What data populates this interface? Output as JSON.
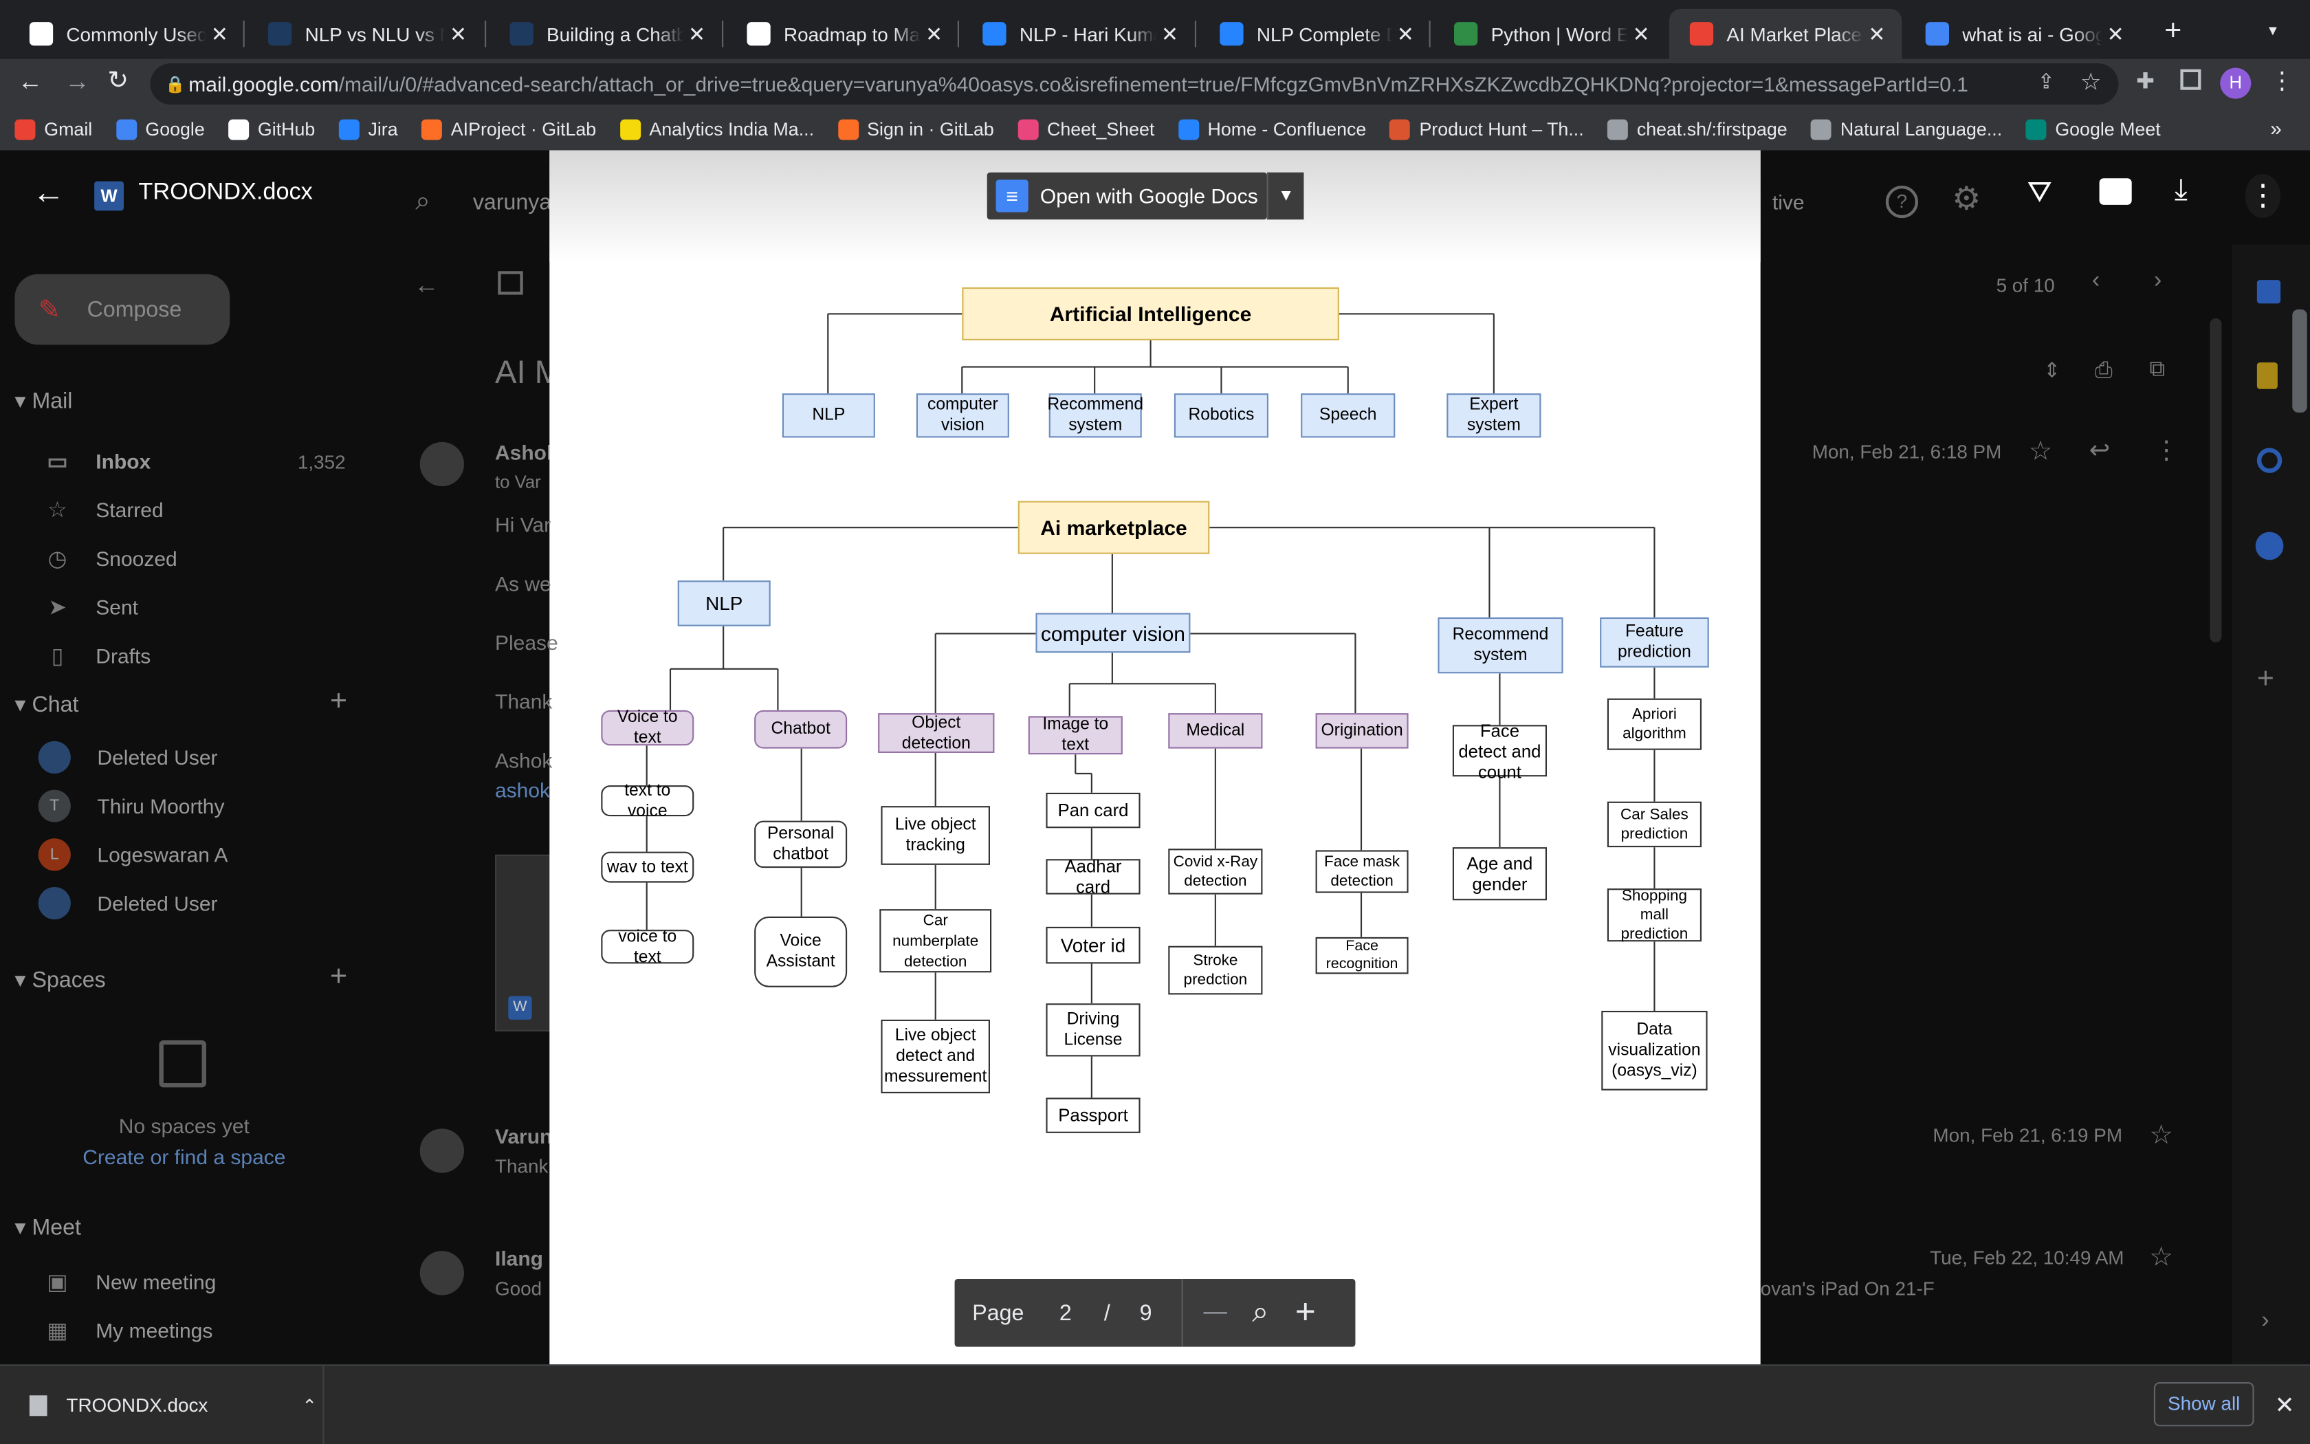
{
  "browser": {
    "tabs": [
      {
        "title": "Commonly Used M",
        "fav": "#ffffff"
      },
      {
        "title": "NLP vs NLU vs NLG",
        "fav": "#1e3a5f"
      },
      {
        "title": "Building a Chatbot",
        "fav": "#1e3a5f"
      },
      {
        "title": "Roadmap to Maste",
        "fav": "#ffffff"
      },
      {
        "title": "NLP - Hari Kumar F",
        "fav": "#2684ff"
      },
      {
        "title": "NLP Complete Doc",
        "fav": "#2684ff"
      },
      {
        "title": "Python | Word Emb",
        "fav": "#2f8d46"
      },
      {
        "title": "AI Market Place - C",
        "fav": "#ea4335"
      },
      {
        "title": "what is ai - Google",
        "fav": "#4285f4"
      }
    ],
    "new_tab": "+",
    "url_host": "mail.google.com",
    "url_path": "/mail/u/0/#advanced-search/attach_or_drive=true&query=varunya%40oasys.co&isrefinement=true/FMfcgzGmvBnVmZRHXsZKZwcdbZQHKDNq?projector=1&messagePartId=0.1",
    "profile": "H",
    "bookmarks": [
      {
        "label": "Gmail",
        "color": "#ea4335"
      },
      {
        "label": "Google",
        "color": "#4285f4"
      },
      {
        "label": "GitHub",
        "color": "#ffffff"
      },
      {
        "label": "Jira",
        "color": "#2684ff"
      },
      {
        "label": "AIProject · GitLab",
        "color": "#fc6d26"
      },
      {
        "label": "Analytics India Ma...",
        "color": "#f5d90a"
      },
      {
        "label": "Sign in · GitLab",
        "color": "#fc6d26"
      },
      {
        "label": "Cheet_Sheet",
        "color": "#e8467c"
      },
      {
        "label": "Home - Confluence",
        "color": "#2684ff"
      },
      {
        "label": "Product Hunt – Th...",
        "color": "#da552f"
      },
      {
        "label": "cheat.sh/:firstpage",
        "color": "#9aa0a6"
      },
      {
        "label": "Natural Language...",
        "color": "#9aa0a6"
      },
      {
        "label": "Google Meet",
        "color": "#00897b"
      }
    ],
    "overflow": "»"
  },
  "gmail": {
    "search_text": "varunya",
    "compose": "Compose",
    "mail_header": "Mail",
    "nav": [
      {
        "label": "Inbox",
        "count": "1,352",
        "icon": "inbox-icon"
      },
      {
        "label": "Starred",
        "count": "",
        "icon": "star-icon"
      },
      {
        "label": "Snoozed",
        "count": "",
        "icon": "clock-icon"
      },
      {
        "label": "Sent",
        "count": "",
        "icon": "send-icon"
      },
      {
        "label": "Drafts",
        "count": "",
        "icon": "draft-icon"
      }
    ],
    "chat_header": "Chat",
    "chats": [
      {
        "name": "Deleted User",
        "initial": "",
        "color": "#3c6db0"
      },
      {
        "name": "Thiru Moorthy",
        "initial": "T",
        "color": "#5f6368"
      },
      {
        "name": "Logeswaran A",
        "initial": "L",
        "color": "#e64a19"
      },
      {
        "name": "Deleted User",
        "initial": "",
        "color": "#3c6db0"
      }
    ],
    "spaces_header": "Spaces",
    "spaces_empty": "No spaces yet",
    "spaces_link": "Create or find a space",
    "meet_header": "Meet",
    "meet": [
      "New meeting",
      "My meetings"
    ],
    "subject_partial": "AI M",
    "pagination": "5 of 10",
    "sender_partial": "Ashok",
    "to_partial": "to Var",
    "body_partial": [
      "Hi Var",
      "As we",
      "Please",
      "Thank",
      "Ashok",
      "ashok"
    ],
    "msg_date": "Mon, Feb 21, 6:18 PM",
    "reply2_sender": "Varun",
    "reply2_text": "Thank",
    "reply2_date": "Mon, Feb 21, 6:19 PM",
    "reply3_sender": "Ilang",
    "reply3_text": "Good",
    "reply3_date": "Tue, Feb 22, 10:49 AM",
    "reply3_tail": "ovan's iPad On 21-F",
    "active_label": "tive"
  },
  "viewer": {
    "file_name": "TROONDX.docx",
    "open_with": "Open with Google Docs",
    "page_label": "Page",
    "page_current": "2",
    "page_sep": "/",
    "page_total": "9",
    "zoom_out": "—",
    "zoom_in": "+"
  },
  "diagram": {
    "ai": {
      "title": "Artificial Intelligence",
      "children": [
        "NLP",
        "computer vision",
        "Recommend system",
        "Robotics",
        "Speech",
        "Expert system"
      ]
    },
    "market": {
      "title": "Ai marketplace",
      "nlp": "NLP",
      "voice_to_text": "Voice to text",
      "text_to_voice": "text to voice",
      "wav_to_text": "wav to text",
      "voice_to_text2": "voice to text",
      "chatbot": "Chatbot",
      "personal_chatbot": "Personal chatbot",
      "voice_assistant": "Voice Assistant",
      "cv": "computer vision",
      "object_detection": "Object detection",
      "live_tracking": "Live object tracking",
      "car_plate": "Car numberplate detection",
      "live_measure": "Live object detect and messurement",
      "image_to_text": "Image to text",
      "pan_card": "Pan card",
      "aadhar": "Aadhar card",
      "voter": "Voter id",
      "driving": "Driving License",
      "passport": "Passport",
      "medical": "Medical",
      "covid": "Covid x-Ray detection",
      "stroke": "Stroke predction",
      "origination": "Origination",
      "face_mask": "Face mask detection",
      "face_recog": "Face recognition",
      "recommend": "Recommend system",
      "face_count": "Face detect and count",
      "age_gender": "Age and gender",
      "feature": "Feature prediction",
      "apriori": "Apriori algorithm",
      "car_sales": "Car Sales prediction",
      "mall": "Shopping mall prediction",
      "dataviz": "Data visualization (oasys_viz)"
    }
  },
  "download": {
    "file": "TROONDX.docx",
    "show_all": "Show all"
  }
}
